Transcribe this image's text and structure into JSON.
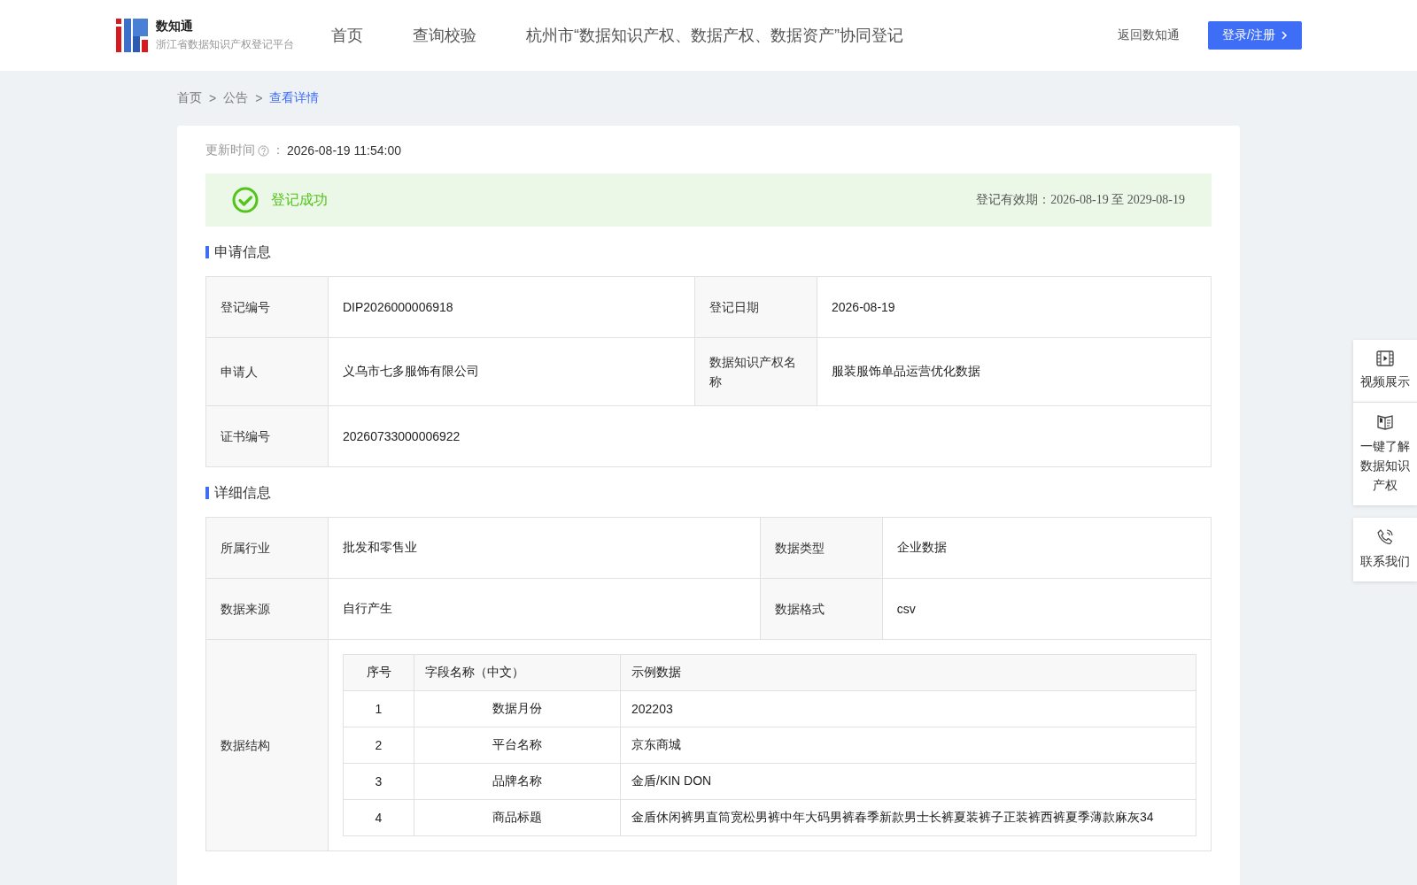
{
  "header": {
    "brand": "数知通",
    "subtitle": "浙江省数据知识产权登记平台",
    "nav": [
      "首页",
      "查询校验",
      "杭州市“数据知识产权、数据产权、数据资产”协同登记"
    ],
    "back_link": "返回数知通",
    "login_button": "登录/注册"
  },
  "breadcrumb": [
    {
      "label": "首页",
      "selected": false
    },
    {
      "label": "公告",
      "selected": false
    },
    {
      "label": "查看详情",
      "selected": true
    }
  ],
  "breadcrumb_separators": [
    ">",
    ">"
  ],
  "update": {
    "label": "更新时间",
    "colon": "：",
    "value": "2026-08-19 11:54:00"
  },
  "status": {
    "kind": "success",
    "text": "登记成功",
    "validity": "登记有效期：2026-08-19 至 2029-08-19"
  },
  "sections": [
    {
      "title": "申请信息",
      "rows": [
        [
          {
            "label": "登记编号",
            "value": "DIP2026000006918"
          },
          {
            "label": "登记日期",
            "value": "2026-08-19"
          }
        ],
        [
          {
            "label": "申请人",
            "value": "义乌市七多服饰有限公司"
          },
          {
            "label": "数据知识产权名称",
            "value": "服装服饰单品运营优化数据"
          }
        ],
        [
          {
            "label": "证书编号",
            "value": "20260733000006922"
          }
        ]
      ]
    },
    {
      "title": "详细信息",
      "rows": [
        [
          {
            "label": "所属行业",
            "value": "批发和零售业"
          },
          {
            "label": "数据类型",
            "value": "企业数据"
          }
        ],
        [
          {
            "label": "数据来源",
            "value": "自行产生"
          },
          {
            "label": "数据格式",
            "value": "csv"
          }
        ]
      ],
      "structure": {
        "label": "数据结构",
        "columns": [
          "序号",
          "字段名称（中文）",
          "示例数据"
        ],
        "rows": [
          [
            "1",
            "数据月份",
            "202203"
          ],
          [
            "2",
            "平台名称",
            "京东商城"
          ],
          [
            "3",
            "品牌名称",
            "金盾/KIN DON"
          ],
          [
            "4",
            "商品标题",
            "金盾休闲裤男直筒宽松男裤中年大码男裤春季新款男士长裤夏装裤子正装裤西裤夏季薄款麻灰34"
          ]
        ]
      }
    }
  ],
  "float_panel": [
    {
      "kind": "video",
      "label": "视频展示"
    },
    {
      "kind": "book",
      "label": "一键了解数据知识产权"
    },
    {
      "kind": "phone",
      "label": "联系我们"
    }
  ]
}
